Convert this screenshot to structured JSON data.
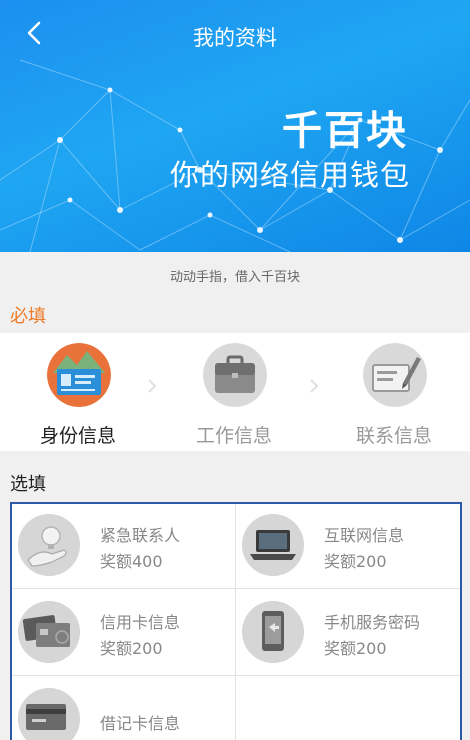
{
  "header": {
    "title": "我的资料",
    "brand": "千百块",
    "slogan": "你的网络信用钱包"
  },
  "tagline": "动动手指，借入千百块",
  "required": {
    "label": "必填",
    "items": [
      {
        "label": "身份信息",
        "icon": "id-card-icon"
      },
      {
        "label": "工作信息",
        "icon": "briefcase-icon"
      },
      {
        "label": "联系信息",
        "icon": "contact-card-icon"
      }
    ]
  },
  "optional": {
    "label": "选填",
    "items": [
      {
        "name": "紧急联系人",
        "bonus": "奖额400",
        "icon": "hand-bulb-icon"
      },
      {
        "name": "互联网信息",
        "bonus": "奖额200",
        "icon": "laptop-icon"
      },
      {
        "name": "信用卡信息",
        "bonus": "奖额200",
        "icon": "credit-card-icon"
      },
      {
        "name": "手机服务密码",
        "bonus": "奖额200",
        "icon": "phone-icon"
      },
      {
        "name": "借记卡信息",
        "bonus": "",
        "icon": "debit-card-icon"
      }
    ]
  },
  "colors": {
    "header_blue": "#1c8ff0",
    "required_label": "#f07a28",
    "optional_border": "#2c5aa8"
  }
}
